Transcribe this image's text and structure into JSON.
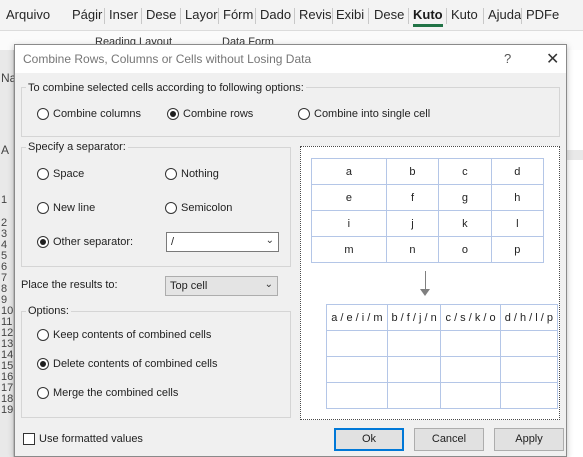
{
  "ribbon": {
    "tabs": [
      "Arquivo",
      "Págir",
      "Inser",
      "Dese",
      "Layor",
      "Fórm",
      "Dado",
      "Revis",
      "Exibi",
      "Dese",
      "Kuto",
      "Kuto",
      "Ajuda",
      "PDFe"
    ],
    "active_tab": "Kuto",
    "body_fragments": [
      "Reading Layout",
      "Data Form"
    ],
    "left_fragments": [
      "Na",
      "A"
    ]
  },
  "sheet": {
    "row_numbers": [
      "1",
      "2",
      "3",
      "4",
      "5",
      "6",
      "7",
      "8",
      "9",
      "10",
      "11",
      "12",
      "13",
      "14",
      "15",
      "16",
      "17",
      "18",
      "19"
    ]
  },
  "dialog": {
    "title": "Combine Rows, Columns or Cells without Losing Data",
    "help_glyph": "?",
    "close_glyph": "✕",
    "combine": {
      "label": "To combine selected cells according to following options:",
      "options": [
        "Combine columns",
        "Combine rows",
        "Combine into single cell"
      ],
      "selected": "Combine rows"
    },
    "separator": {
      "label": "Specify a separator:",
      "space": "Space",
      "nothing": "Nothing",
      "new_line": "New line",
      "semicolon": "Semicolon",
      "other": "Other separator:",
      "selected": "Other separator:",
      "other_value": "/"
    },
    "place": {
      "label": "Place the results to:",
      "value": "Top cell"
    },
    "options": {
      "label": "Options:",
      "keep": "Keep contents of combined cells",
      "delete": "Delete contents of combined cells",
      "merge": "Merge the combined cells",
      "selected": "Delete contents of combined cells"
    },
    "preview": {
      "source": [
        [
          "a",
          "b",
          "c",
          "d"
        ],
        [
          "e",
          "f",
          "g",
          "h"
        ],
        [
          "i",
          "j",
          "k",
          "l"
        ],
        [
          "m",
          "n",
          "o",
          "p"
        ]
      ],
      "result": [
        [
          "a / e / i / m",
          "b / f / j / n",
          "c / s / k / o",
          "d / h / l / p"
        ],
        [
          "",
          "",
          "",
          ""
        ],
        [
          "",
          "",
          "",
          ""
        ],
        [
          "",
          "",
          "",
          ""
        ]
      ]
    },
    "use_formatted": "Use formatted values",
    "use_formatted_checked": false,
    "buttons": {
      "ok": "Ok",
      "cancel": "Cancel",
      "apply": "Apply"
    }
  }
}
